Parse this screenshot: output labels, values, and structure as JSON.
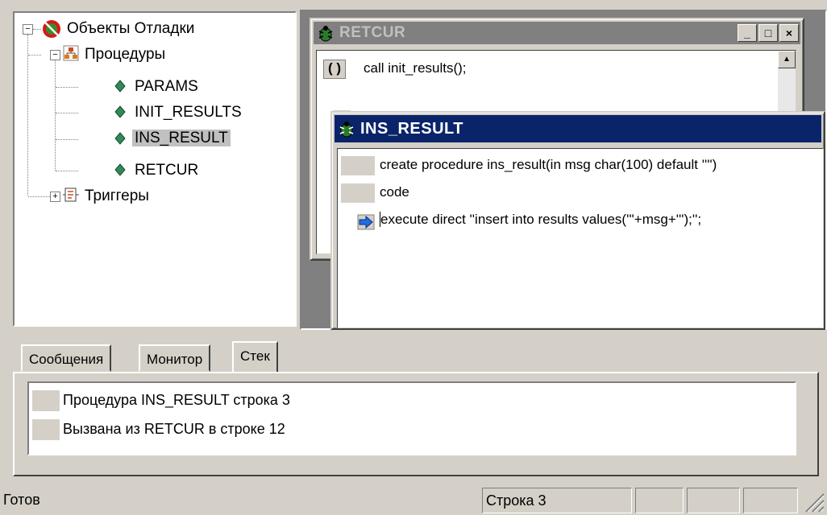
{
  "tree": {
    "root_label": "Объекты Отладки",
    "procedures_label": "Процедуры",
    "items": [
      "PARAMS",
      "INIT_RESULTS",
      "INS_RESULT",
      "RETCUR"
    ],
    "triggers_label": "Триггеры",
    "selected": "INS_RESULT"
  },
  "windows": {
    "retcur": {
      "title": "RETCUR",
      "line1": "call init_results();"
    },
    "ins_result": {
      "title": "INS_RESULT",
      "lines": [
        "create procedure ins_result(in msg char(100) default '''')",
        "code",
        "execute direct ''insert into results values('''+msg+''');'';"
      ]
    }
  },
  "tabs": [
    "Сообщения",
    "Монитор",
    "Стек"
  ],
  "active_tab": "Стек",
  "stack": [
    "Процедура INS_RESULT строка 3",
    "Вызвана из RETCUR в строке 12"
  ],
  "status": {
    "text": "Готов",
    "line": "Строка 3"
  },
  "colors": {
    "active_title": "#0a246a",
    "inactive_title": "#808080",
    "face": "#d4d0c8"
  }
}
